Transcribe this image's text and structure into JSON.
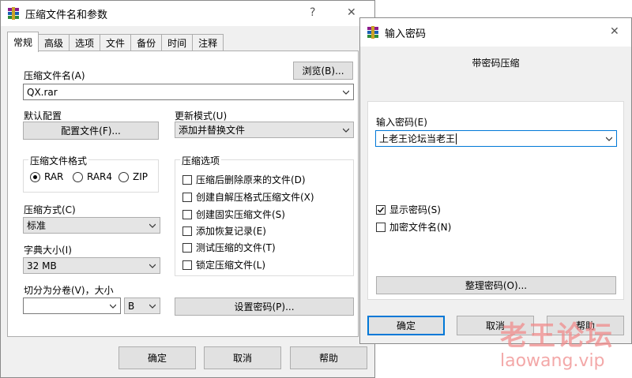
{
  "colors": {
    "accent": "#0078d7",
    "watermark": "#f08c8c"
  },
  "main_dialog": {
    "title": "压缩文件名和参数",
    "help_glyph": "?",
    "close_glyph": "✕",
    "tabs": [
      "常规",
      "高级",
      "选项",
      "文件",
      "备份",
      "时间",
      "注释"
    ],
    "active_tab": "常规",
    "archive_name_label": "压缩文件名(A)",
    "browse_button": "浏览(B)...",
    "archive_name_value": "QX.rar",
    "default_profile_label": "默认配置",
    "profiles_button": "配置文件(F)...",
    "update_mode_label": "更新模式(U)",
    "update_mode_value": "添加并替换文件",
    "format_group_title": "压缩文件格式",
    "formats": [
      {
        "label": "RAR",
        "selected": true
      },
      {
        "label": "RAR4",
        "selected": false
      },
      {
        "label": "ZIP",
        "selected": false
      }
    ],
    "options_group_title": "压缩选项",
    "options": [
      {
        "label": "压缩后删除原来的文件(D)",
        "checked": false
      },
      {
        "label": "创建自解压格式压缩文件(X)",
        "checked": false
      },
      {
        "label": "创建固实压缩文件(S)",
        "checked": false
      },
      {
        "label": "添加恢复记录(E)",
        "checked": false
      },
      {
        "label": "测试压缩的文件(T)",
        "checked": false
      },
      {
        "label": "锁定压缩文件(L)",
        "checked": false
      }
    ],
    "method_label": "压缩方式(C)",
    "method_value": "标准",
    "dict_label": "字典大小(I)",
    "dict_value": "32 MB",
    "split_label": "切分为分卷(V)，大小",
    "split_value": "",
    "split_unit": "B",
    "set_password_button": "设置密码(P)...",
    "ok_button": "确定",
    "cancel_button": "取消",
    "help_button": "帮助"
  },
  "password_dialog": {
    "title": "输入密码",
    "close_glyph": "✕",
    "header": "带密码压缩",
    "password_label": "输入密码(E)",
    "password_value": "上老王论坛当老王",
    "show_password_label": "显示密码(S)",
    "show_password_checked": true,
    "encrypt_names_label": "加密文件名(N)",
    "encrypt_names_checked": false,
    "organize_button": "整理密码(O)...",
    "ok_button": "确定",
    "cancel_button": "取消",
    "help_button": "帮助"
  },
  "watermark": {
    "text_cn": "老王论坛",
    "text_url": "laowang.vip"
  }
}
